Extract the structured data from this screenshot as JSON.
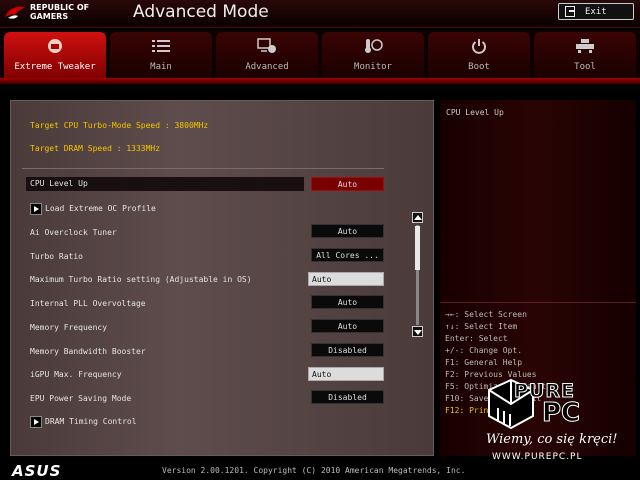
{
  "header": {
    "brand_line1": "REPUBLIC OF",
    "brand_line2": "GAMERS",
    "title": "Advanced Mode",
    "exit_label": "Exit"
  },
  "tabs": [
    {
      "label": "Extreme Tweaker",
      "icon": "extreme-tweaker-icon",
      "active": true
    },
    {
      "label": "Main",
      "icon": "list-icon",
      "active": false
    },
    {
      "label": "Advanced",
      "icon": "advanced-settings-icon",
      "active": false
    },
    {
      "label": "Monitor",
      "icon": "thermometer-fan-icon",
      "active": false
    },
    {
      "label": "Boot",
      "icon": "power-icon",
      "active": false
    },
    {
      "label": "Tool",
      "icon": "tool-icon",
      "active": false
    }
  ],
  "info": {
    "cpu_turbo": "Target CPU Turbo-Mode Speed : 3800MHz",
    "dram_speed": "Target DRAM Speed : 1333MHz"
  },
  "settings": [
    {
      "label": "CPU Level Up",
      "value": "Auto"
    },
    {
      "label": "Load Extreme OC Profile"
    },
    {
      "label": "Ai Overclock Tuner",
      "value": "Auto"
    },
    {
      "label": "Turbo Ratio",
      "value": "All Cores ..."
    },
    {
      "label": "Maximum Turbo Ratio setting (Adjustable in OS)",
      "value": "Auto"
    },
    {
      "label": "Internal PLL Overvoltage",
      "value": "Auto"
    },
    {
      "label": "Memory Frequency",
      "value": "Auto"
    },
    {
      "label": "Memory Bandwidth Booster",
      "value": "Disabled"
    },
    {
      "label": "iGPU Max. Frequency",
      "value": "Auto"
    },
    {
      "label": "EPU Power Saving Mode",
      "value": "Disabled"
    },
    {
      "label": "DRAM Timing Control"
    }
  ],
  "help": {
    "title": "CPU Level Up",
    "keys": [
      "→←: Select Screen",
      "↑↓: Select Item",
      "Enter: Select",
      "+/-: Change Opt.",
      "F1: General Help",
      "F2: Previous Values",
      "F5: Optimized Defaults",
      "F10: Save  ESC: Exit",
      "F12: Print Screen"
    ]
  },
  "watermark": {
    "brand_top": "PURE",
    "brand_bottom": "PC",
    "slogan": "Wiemy, co się kręci!",
    "url": "WWW.PUREPC.PL"
  },
  "footer": {
    "logo": "ASUS",
    "version": "Version 2.00.1201. Copyright (C) 2010 American Megatrends, Inc."
  },
  "colors": {
    "accent_red": "#d01010",
    "highlight_yellow": "#f4c400",
    "value_box_red": "#7a0000"
  }
}
